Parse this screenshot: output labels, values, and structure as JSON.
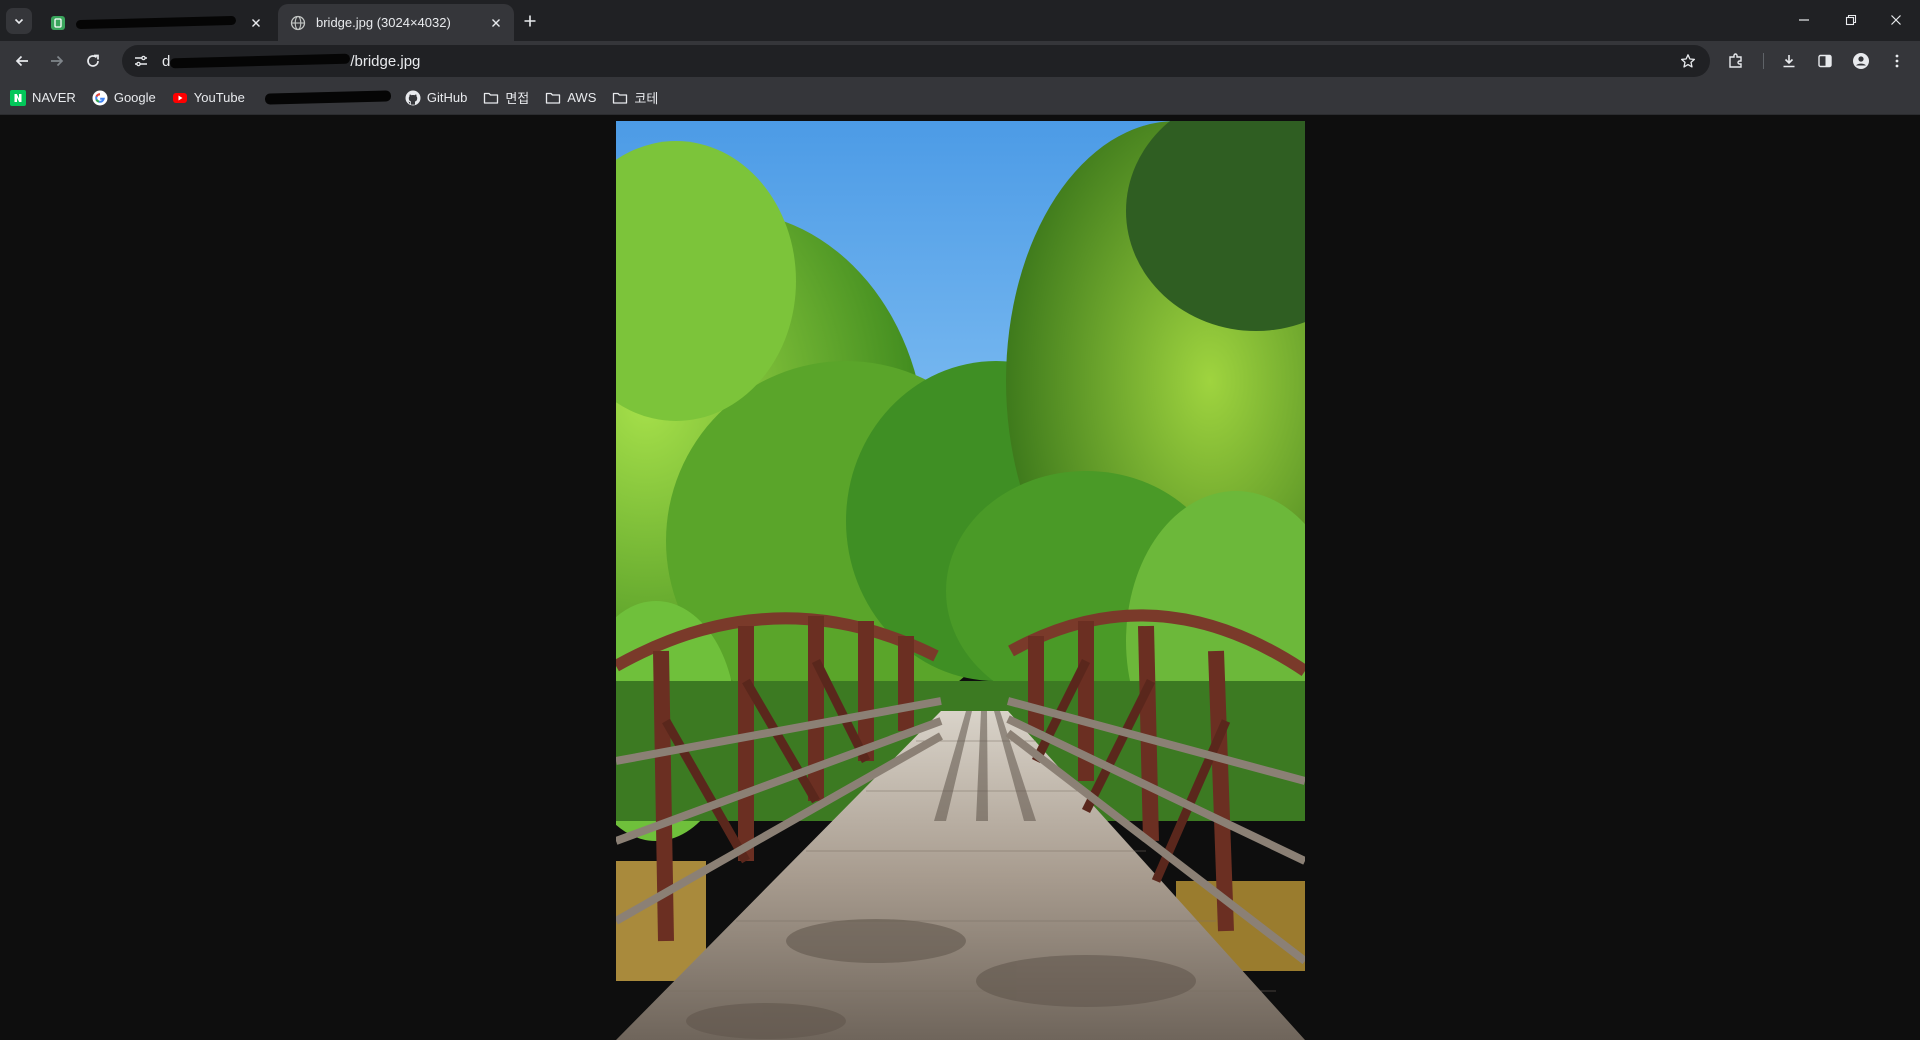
{
  "tabs": [
    {
      "title": "",
      "redacted": true,
      "favicon": "green-app-icon"
    },
    {
      "title": "bridge.jpg (3024×4032)",
      "favicon": "globe-icon"
    }
  ],
  "address_bar": {
    "url_prefix_redacted": true,
    "url_visible": "d",
    "url_suffix": "/bridge.jpg"
  },
  "bookmarks": [
    {
      "label": "NAVER",
      "icon": "naver-icon"
    },
    {
      "label": "Google",
      "icon": "google-icon"
    },
    {
      "label": "YouTube",
      "icon": "youtube-icon"
    },
    {
      "label": "",
      "redacted": true
    },
    {
      "label": "GitHub",
      "icon": "github-icon"
    },
    {
      "label": "면접",
      "icon": "folder-icon"
    },
    {
      "label": "AWS",
      "icon": "folder-icon"
    },
    {
      "label": "코테",
      "icon": "folder-icon"
    }
  ],
  "image": {
    "alt": "bridge.jpg",
    "colors": {
      "sky": "#5aa9ec",
      "foliage": "#5aa52a",
      "rail": "#6b2f22",
      "deck": "#9a8f84"
    }
  },
  "colors": {
    "tabstrip": "#202124",
    "toolbar": "#35363a",
    "page_bg": "#0e0e0e"
  }
}
